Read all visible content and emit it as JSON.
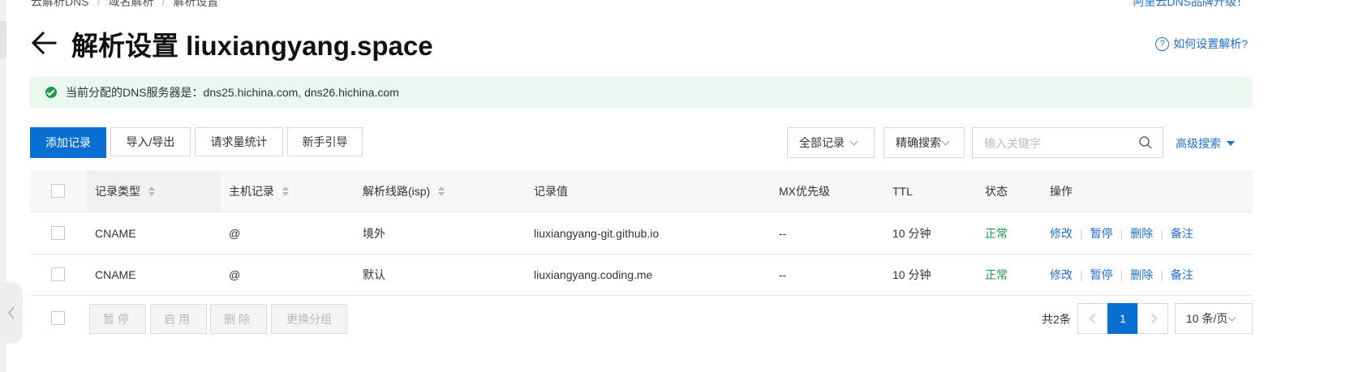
{
  "breadcrumb": [
    "云解析DNS",
    "域名解析",
    "解析设置"
  ],
  "top_link": "阿里云DNS品牌升级！",
  "page": {
    "title": "解析设置 liuxiangyang.space",
    "help_link": "如何设置解析?"
  },
  "dns_banner": {
    "text": "当前分配的DNS服务器是：dns25.hichina.com, dns26.hichina.com"
  },
  "toolbar": {
    "add_record": "添加记录",
    "import_export": "导入/导出",
    "request_stats": "请求量统计",
    "beginner_guide": "新手引导",
    "filter_select": "全部记录",
    "search_mode": "精确搜索",
    "search_placeholder": "输入关键字",
    "advanced_search": "高级搜索"
  },
  "table": {
    "headers": {
      "type": "记录类型",
      "host": "主机记录",
      "line": "解析线路(isp)",
      "value": "记录值",
      "mx": "MX优先级",
      "ttl": "TTL",
      "status": "状态",
      "ops": "操作"
    },
    "rows": [
      {
        "type": "CNAME",
        "host": "@",
        "line": "境外",
        "value": "liuxiangyang-git.github.io",
        "mx": "--",
        "ttl": "10 分钟",
        "status": "正常"
      },
      {
        "type": "CNAME",
        "host": "@",
        "line": "默认",
        "value": "liuxiangyang.coding.me",
        "mx": "--",
        "ttl": "10 分钟",
        "status": "正常"
      }
    ],
    "row_ops": [
      "修改",
      "暂停",
      "删除",
      "备注"
    ]
  },
  "bulk_actions": {
    "pause": "暂停",
    "enable": "启用",
    "delete": "删除",
    "change_group": "更换分组"
  },
  "pagination": {
    "total": "共2条",
    "current_page": "1",
    "page_size": "10 条/页"
  },
  "colors": {
    "primary": "#0a6fd2",
    "link": "#1f6fd1",
    "success": "#1e9a4a",
    "banner_bg": "#eaf8ef"
  }
}
